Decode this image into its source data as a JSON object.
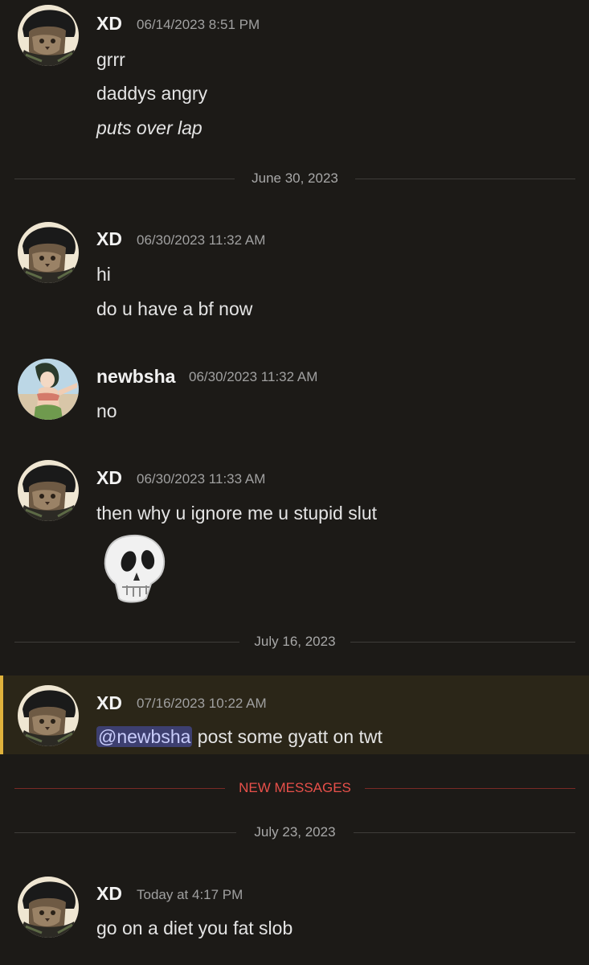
{
  "messages": [
    {
      "author": "XD",
      "timestamp": "06/14/2023 8:51 PM",
      "lines": [
        "grrr",
        "daddys angry",
        "puts over lap"
      ]
    },
    {
      "author": "XD",
      "timestamp": "06/30/2023 11:32 AM",
      "lines": [
        "hi",
        "do u have a bf now"
      ]
    },
    {
      "author": "newbsha",
      "timestamp": "06/30/2023 11:32 AM",
      "lines": [
        "no"
      ]
    },
    {
      "author": "XD",
      "timestamp": "06/30/2023 11:33 AM",
      "lines": [
        "then why u ignore me u stupid slut"
      ],
      "emoji": "skull-emoji"
    },
    {
      "author": "XD",
      "timestamp": "07/16/2023 10:22 AM",
      "mention": "@newbsha",
      "text": " post some gyatt on twt"
    },
    {
      "author": "XD",
      "timestamp": "Today at 4:17 PM",
      "lines": [
        "go on a diet you fat slob"
      ]
    }
  ],
  "dividers": {
    "june30": "June 30, 2023",
    "july16": "July 16, 2023",
    "new_messages": "NEW MESSAGES",
    "july23": "July 23, 2023"
  },
  "colors": {
    "background": "#1c1a17",
    "highlight_bg": "#2b2618",
    "highlight_bar": "#e0b23c",
    "mention_bg": "#3d3f70",
    "new_messages": "#e8504a"
  }
}
